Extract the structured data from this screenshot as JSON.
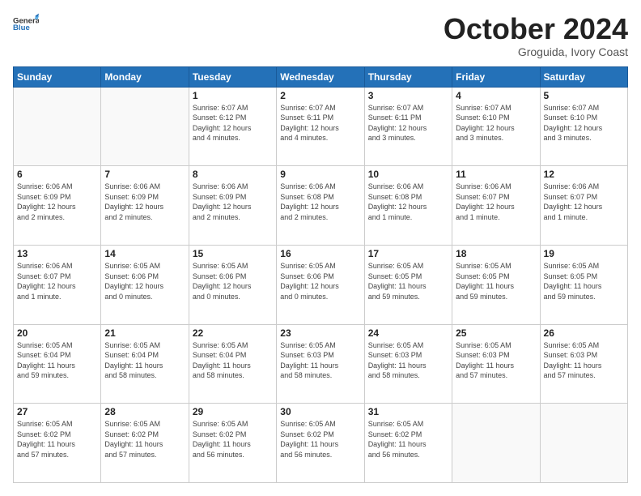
{
  "logo": {
    "line1": "General",
    "line2": "Blue"
  },
  "title": "October 2024",
  "subtitle": "Groguida, Ivory Coast",
  "days_header": [
    "Sunday",
    "Monday",
    "Tuesday",
    "Wednesday",
    "Thursday",
    "Friday",
    "Saturday"
  ],
  "weeks": [
    [
      {
        "day": "",
        "info": ""
      },
      {
        "day": "",
        "info": ""
      },
      {
        "day": "1",
        "info": "Sunrise: 6:07 AM\nSunset: 6:12 PM\nDaylight: 12 hours\nand 4 minutes."
      },
      {
        "day": "2",
        "info": "Sunrise: 6:07 AM\nSunset: 6:11 PM\nDaylight: 12 hours\nand 4 minutes."
      },
      {
        "day": "3",
        "info": "Sunrise: 6:07 AM\nSunset: 6:11 PM\nDaylight: 12 hours\nand 3 minutes."
      },
      {
        "day": "4",
        "info": "Sunrise: 6:07 AM\nSunset: 6:10 PM\nDaylight: 12 hours\nand 3 minutes."
      },
      {
        "day": "5",
        "info": "Sunrise: 6:07 AM\nSunset: 6:10 PM\nDaylight: 12 hours\nand 3 minutes."
      }
    ],
    [
      {
        "day": "6",
        "info": "Sunrise: 6:06 AM\nSunset: 6:09 PM\nDaylight: 12 hours\nand 2 minutes."
      },
      {
        "day": "7",
        "info": "Sunrise: 6:06 AM\nSunset: 6:09 PM\nDaylight: 12 hours\nand 2 minutes."
      },
      {
        "day": "8",
        "info": "Sunrise: 6:06 AM\nSunset: 6:09 PM\nDaylight: 12 hours\nand 2 minutes."
      },
      {
        "day": "9",
        "info": "Sunrise: 6:06 AM\nSunset: 6:08 PM\nDaylight: 12 hours\nand 2 minutes."
      },
      {
        "day": "10",
        "info": "Sunrise: 6:06 AM\nSunset: 6:08 PM\nDaylight: 12 hours\nand 1 minute."
      },
      {
        "day": "11",
        "info": "Sunrise: 6:06 AM\nSunset: 6:07 PM\nDaylight: 12 hours\nand 1 minute."
      },
      {
        "day": "12",
        "info": "Sunrise: 6:06 AM\nSunset: 6:07 PM\nDaylight: 12 hours\nand 1 minute."
      }
    ],
    [
      {
        "day": "13",
        "info": "Sunrise: 6:06 AM\nSunset: 6:07 PM\nDaylight: 12 hours\nand 1 minute."
      },
      {
        "day": "14",
        "info": "Sunrise: 6:05 AM\nSunset: 6:06 PM\nDaylight: 12 hours\nand 0 minutes."
      },
      {
        "day": "15",
        "info": "Sunrise: 6:05 AM\nSunset: 6:06 PM\nDaylight: 12 hours\nand 0 minutes."
      },
      {
        "day": "16",
        "info": "Sunrise: 6:05 AM\nSunset: 6:06 PM\nDaylight: 12 hours\nand 0 minutes."
      },
      {
        "day": "17",
        "info": "Sunrise: 6:05 AM\nSunset: 6:05 PM\nDaylight: 11 hours\nand 59 minutes."
      },
      {
        "day": "18",
        "info": "Sunrise: 6:05 AM\nSunset: 6:05 PM\nDaylight: 11 hours\nand 59 minutes."
      },
      {
        "day": "19",
        "info": "Sunrise: 6:05 AM\nSunset: 6:05 PM\nDaylight: 11 hours\nand 59 minutes."
      }
    ],
    [
      {
        "day": "20",
        "info": "Sunrise: 6:05 AM\nSunset: 6:04 PM\nDaylight: 11 hours\nand 59 minutes."
      },
      {
        "day": "21",
        "info": "Sunrise: 6:05 AM\nSunset: 6:04 PM\nDaylight: 11 hours\nand 58 minutes."
      },
      {
        "day": "22",
        "info": "Sunrise: 6:05 AM\nSunset: 6:04 PM\nDaylight: 11 hours\nand 58 minutes."
      },
      {
        "day": "23",
        "info": "Sunrise: 6:05 AM\nSunset: 6:03 PM\nDaylight: 11 hours\nand 58 minutes."
      },
      {
        "day": "24",
        "info": "Sunrise: 6:05 AM\nSunset: 6:03 PM\nDaylight: 11 hours\nand 58 minutes."
      },
      {
        "day": "25",
        "info": "Sunrise: 6:05 AM\nSunset: 6:03 PM\nDaylight: 11 hours\nand 57 minutes."
      },
      {
        "day": "26",
        "info": "Sunrise: 6:05 AM\nSunset: 6:03 PM\nDaylight: 11 hours\nand 57 minutes."
      }
    ],
    [
      {
        "day": "27",
        "info": "Sunrise: 6:05 AM\nSunset: 6:02 PM\nDaylight: 11 hours\nand 57 minutes."
      },
      {
        "day": "28",
        "info": "Sunrise: 6:05 AM\nSunset: 6:02 PM\nDaylight: 11 hours\nand 57 minutes."
      },
      {
        "day": "29",
        "info": "Sunrise: 6:05 AM\nSunset: 6:02 PM\nDaylight: 11 hours\nand 56 minutes."
      },
      {
        "day": "30",
        "info": "Sunrise: 6:05 AM\nSunset: 6:02 PM\nDaylight: 11 hours\nand 56 minutes."
      },
      {
        "day": "31",
        "info": "Sunrise: 6:05 AM\nSunset: 6:02 PM\nDaylight: 11 hours\nand 56 minutes."
      },
      {
        "day": "",
        "info": ""
      },
      {
        "day": "",
        "info": ""
      }
    ]
  ]
}
